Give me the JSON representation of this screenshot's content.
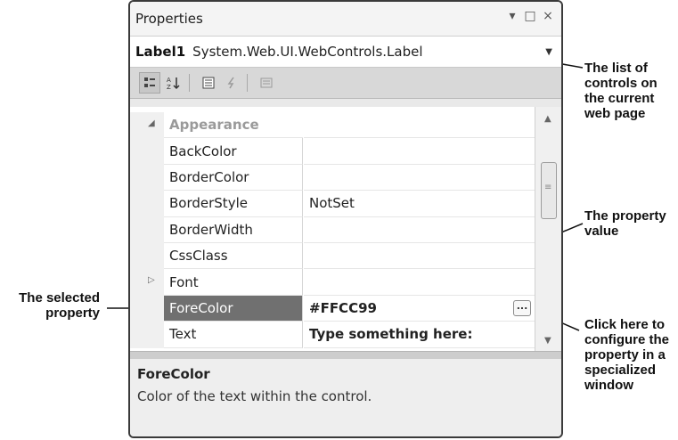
{
  "window": {
    "title": "Properties",
    "buttons": [
      "▾",
      "□",
      "×"
    ]
  },
  "object_selector": {
    "name": "Label1",
    "type": "System.Web.UI.WebControls.Label"
  },
  "toolbar": {
    "icons": [
      "categorized-icon",
      "alphabetical-icon",
      "properties-icon",
      "events-icon",
      "property-pages-icon"
    ]
  },
  "grid": {
    "category": "Appearance",
    "rows": [
      {
        "name": "BackColor",
        "value": ""
      },
      {
        "name": "BorderColor",
        "value": ""
      },
      {
        "name": "BorderStyle",
        "value": "NotSet"
      },
      {
        "name": "BorderWidth",
        "value": ""
      },
      {
        "name": "CssClass",
        "value": ""
      },
      {
        "name": "Font",
        "value": ""
      },
      {
        "name": "ForeColor",
        "value": "#FFCC99"
      },
      {
        "name": "Text",
        "value": "Type something here:"
      }
    ]
  },
  "description": {
    "title": "ForeColor",
    "text": "Color of the text within the control."
  },
  "callouts": {
    "controls_list": "The list of\ncontrols on\nthe current\nweb page",
    "property_value": "The property\nvalue",
    "selected_property": "The selected\nproperty",
    "builder_button": "Click here to\nconfigure the\nproperty in a\nspecialized\nwindow"
  }
}
